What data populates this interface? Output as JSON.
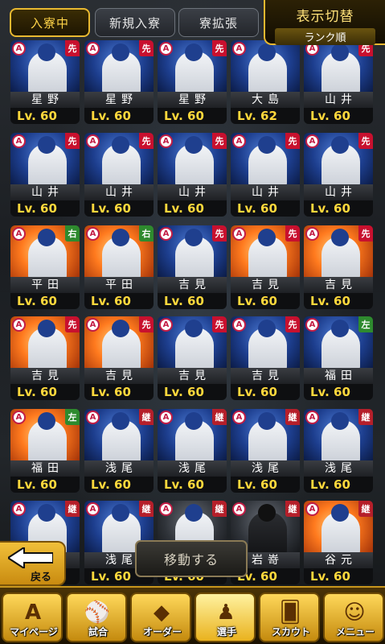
{
  "tabs": [
    {
      "label": "入寮中",
      "active": true
    },
    {
      "label": "新規入寮",
      "active": false
    },
    {
      "label": "寮拡張",
      "active": false
    }
  ],
  "display_switch": {
    "title": "表示切替",
    "value": "ランク順"
  },
  "rank_badge": "A",
  "cards": [
    {
      "name": "星野",
      "level": "Lv. 60",
      "pos": "先",
      "posColor": "red",
      "bg": "blue",
      "uniform": "white"
    },
    {
      "name": "星野",
      "level": "Lv. 60",
      "pos": "先",
      "posColor": "red",
      "bg": "blue",
      "uniform": "white"
    },
    {
      "name": "星野",
      "level": "Lv. 60",
      "pos": "先",
      "posColor": "red",
      "bg": "blue",
      "uniform": "white"
    },
    {
      "name": "大島",
      "level": "Lv. 62",
      "pos": "",
      "posColor": "",
      "bg": "blue",
      "uniform": "white"
    },
    {
      "name": "山井",
      "level": "Lv. 60",
      "pos": "先",
      "posColor": "red",
      "bg": "blue",
      "uniform": "white"
    },
    {
      "name": "山井",
      "level": "Lv. 60",
      "pos": "先",
      "posColor": "red",
      "bg": "blue",
      "uniform": "white"
    },
    {
      "name": "山井",
      "level": "Lv. 60",
      "pos": "先",
      "posColor": "red",
      "bg": "blue",
      "uniform": "white"
    },
    {
      "name": "山井",
      "level": "Lv. 60",
      "pos": "先",
      "posColor": "red",
      "bg": "blue",
      "uniform": "white"
    },
    {
      "name": "山井",
      "level": "Lv. 60",
      "pos": "先",
      "posColor": "red",
      "bg": "blue",
      "uniform": "white"
    },
    {
      "name": "山井",
      "level": "Lv. 60",
      "pos": "先",
      "posColor": "red",
      "bg": "blue",
      "uniform": "white"
    },
    {
      "name": "平田",
      "level": "Lv. 60",
      "pos": "右",
      "posColor": "green",
      "bg": "orange",
      "uniform": "white"
    },
    {
      "name": "平田",
      "level": "Lv. 60",
      "pos": "右",
      "posColor": "green",
      "bg": "orange",
      "uniform": "white"
    },
    {
      "name": "吉見",
      "level": "Lv. 60",
      "pos": "先",
      "posColor": "red",
      "bg": "blue",
      "uniform": "white"
    },
    {
      "name": "吉見",
      "level": "Lv. 60",
      "pos": "先",
      "posColor": "red",
      "bg": "orange",
      "uniform": "white"
    },
    {
      "name": "吉見",
      "level": "Lv. 60",
      "pos": "先",
      "posColor": "red",
      "bg": "orange",
      "uniform": "white"
    },
    {
      "name": "吉見",
      "level": "Lv. 60",
      "pos": "先",
      "posColor": "red",
      "bg": "orange",
      "uniform": "white"
    },
    {
      "name": "吉見",
      "level": "Lv. 60",
      "pos": "先",
      "posColor": "red",
      "bg": "orange",
      "uniform": "white"
    },
    {
      "name": "吉見",
      "level": "Lv. 60",
      "pos": "先",
      "posColor": "red",
      "bg": "blue",
      "uniform": "white"
    },
    {
      "name": "吉見",
      "level": "Lv. 60",
      "pos": "先",
      "posColor": "red",
      "bg": "blue",
      "uniform": "white"
    },
    {
      "name": "福田",
      "level": "Lv. 60",
      "pos": "左",
      "posColor": "green",
      "bg": "blue",
      "uniform": "white"
    },
    {
      "name": "福田",
      "level": "Lv. 60",
      "pos": "左",
      "posColor": "green",
      "bg": "orange",
      "uniform": "white"
    },
    {
      "name": "浅尾",
      "level": "Lv. 60",
      "pos": "継",
      "posColor": "redd",
      "bg": "blue",
      "uniform": "white"
    },
    {
      "name": "浅尾",
      "level": "Lv. 60",
      "pos": "継",
      "posColor": "redd",
      "bg": "blue",
      "uniform": "white"
    },
    {
      "name": "浅尾",
      "level": "Lv. 60",
      "pos": "継",
      "posColor": "redd",
      "bg": "blue",
      "uniform": "white"
    },
    {
      "name": "浅尾",
      "level": "Lv. 60",
      "pos": "継",
      "posColor": "redd",
      "bg": "blue",
      "uniform": "white"
    },
    {
      "name": "",
      "level": "Lv. 60",
      "pos": "継",
      "posColor": "redd",
      "bg": "blue",
      "uniform": "white"
    },
    {
      "name": "浅尾",
      "level": "Lv. 60",
      "pos": "継",
      "posColor": "redd",
      "bg": "blue",
      "uniform": "white"
    },
    {
      "name": "",
      "level": "Lv. 60",
      "pos": "継",
      "posColor": "redd",
      "bg": "dark",
      "uniform": "white"
    },
    {
      "name": "岩嵜",
      "level": "Lv. 60",
      "pos": "継",
      "posColor": "redd",
      "bg": "dark",
      "uniform": "dark"
    },
    {
      "name": "谷元",
      "level": "Lv. 60",
      "pos": "継",
      "posColor": "redd",
      "bg": "orange",
      "uniform": "white"
    }
  ],
  "move_button": "移動する",
  "back_button": "戻る",
  "nav": [
    {
      "label": "マイページ",
      "icon": "rank-a-icon",
      "glyph": "A"
    },
    {
      "label": "試合",
      "icon": "stadium-icon",
      "glyph": "⚾"
    },
    {
      "label": "オーダー",
      "icon": "field-icon",
      "glyph": "◆"
    },
    {
      "label": "選手",
      "icon": "player-icon",
      "glyph": "♟"
    },
    {
      "label": "スカウト",
      "icon": "scout-card-icon",
      "glyph": "🂠"
    },
    {
      "label": "メニュー",
      "icon": "menu-character-icon",
      "glyph": "☺"
    }
  ]
}
